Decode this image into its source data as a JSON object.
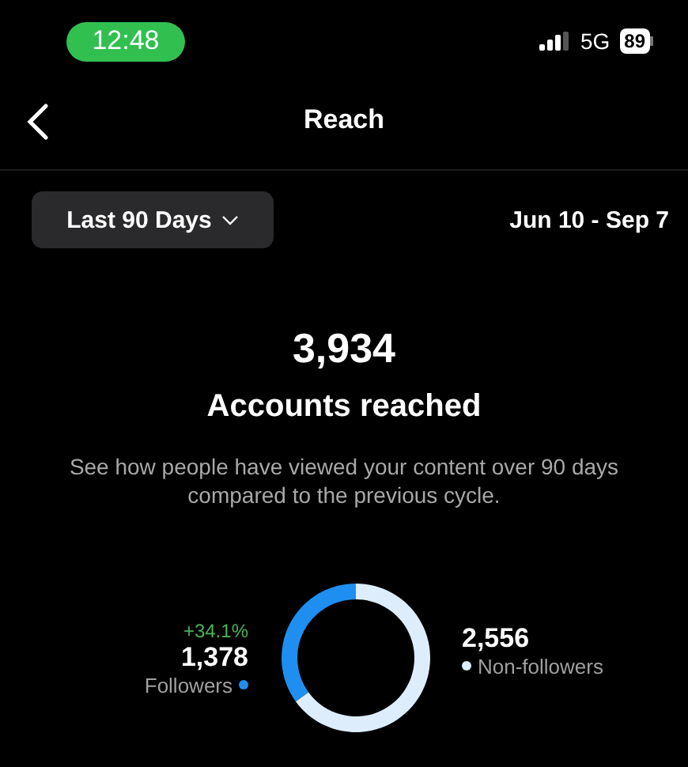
{
  "status_bar": {
    "time": "12:48",
    "network": "5G",
    "battery": "89"
  },
  "nav": {
    "title": "Reach"
  },
  "filter": {
    "period": "Last 90 Days",
    "date_range": "Jun 10 - Sep 7"
  },
  "summary": {
    "value": "3,934",
    "label": "Accounts reached",
    "description": "See how people have viewed your content over 90 days compared to the previous cycle."
  },
  "breakdown": {
    "items": [
      {
        "kind": "followers",
        "change": "+34.1%",
        "value": "1,378",
        "color": "#1e8ff0"
      },
      {
        "kind": "non_followers",
        "value": "2,556",
        "color": "#ddedfc"
      }
    ],
    "chart_data": {
      "type": "donut",
      "categories": [
        "Followers",
        "Non-followers"
      ],
      "values": [
        35,
        65
      ]
    }
  }
}
